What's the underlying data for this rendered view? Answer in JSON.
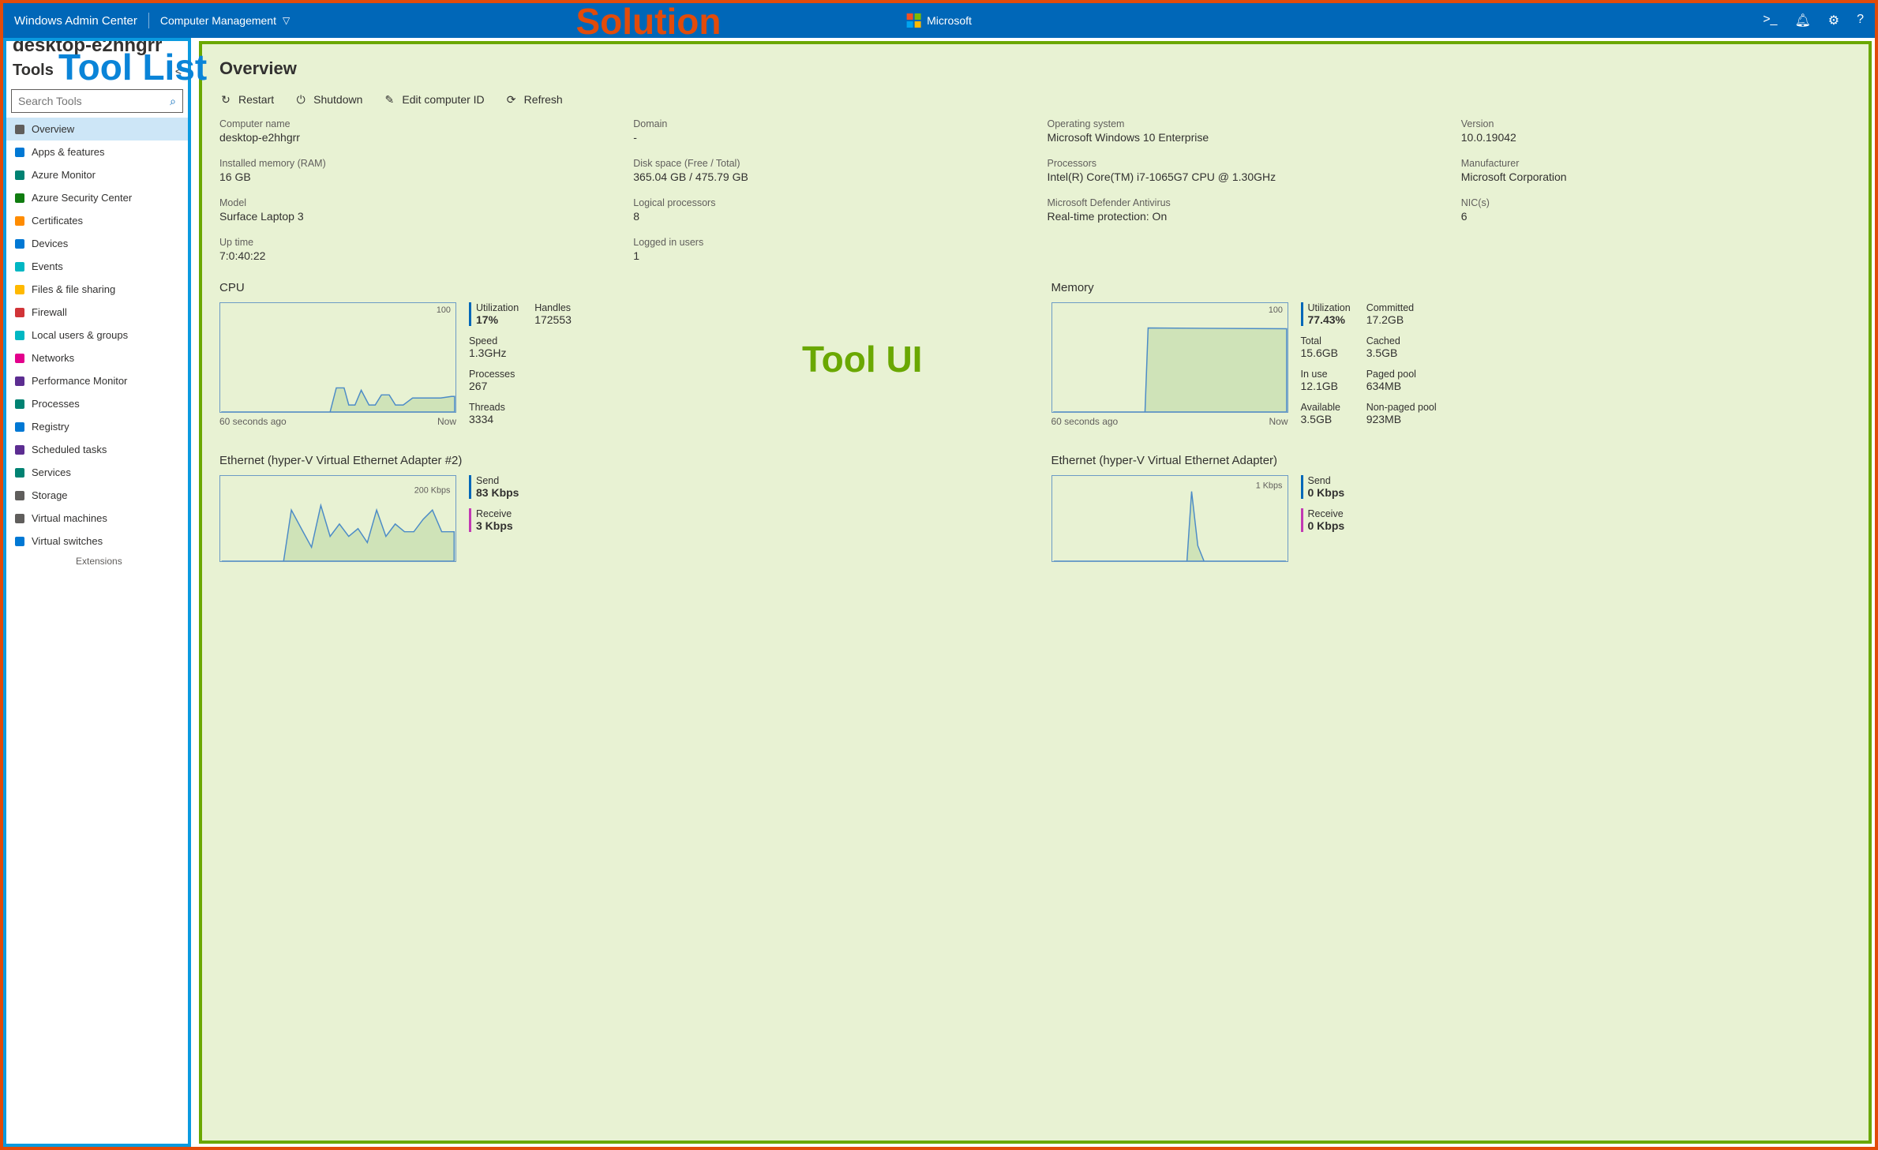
{
  "header": {
    "app_title": "Windows Admin Center",
    "solution_name": "Computer Management",
    "brand": "Microsoft"
  },
  "annotations": {
    "solution": "Solution",
    "tool_list": "Tool List",
    "tool_ui": "Tool UI"
  },
  "sidebar": {
    "connection_name": "desktop-e2hhgrr",
    "tools_label": "Tools",
    "search_placeholder": "Search Tools",
    "extensions_label": "Extensions",
    "items": [
      {
        "label": "Overview",
        "active": true
      },
      {
        "label": "Apps & features"
      },
      {
        "label": "Azure Monitor"
      },
      {
        "label": "Azure Security Center"
      },
      {
        "label": "Certificates"
      },
      {
        "label": "Devices"
      },
      {
        "label": "Events"
      },
      {
        "label": "Files & file sharing"
      },
      {
        "label": "Firewall"
      },
      {
        "label": "Local users & groups"
      },
      {
        "label": "Networks"
      },
      {
        "label": "Performance Monitor"
      },
      {
        "label": "Processes"
      },
      {
        "label": "Registry"
      },
      {
        "label": "Scheduled tasks"
      },
      {
        "label": "Services"
      },
      {
        "label": "Storage"
      },
      {
        "label": "Virtual machines"
      },
      {
        "label": "Virtual switches"
      }
    ]
  },
  "page": {
    "title": "Overview",
    "commands": {
      "restart": "Restart",
      "shutdown": "Shutdown",
      "edit_id": "Edit computer ID",
      "refresh": "Refresh"
    },
    "info": [
      {
        "lbl": "Computer name",
        "val": "desktop-e2hhgrr"
      },
      {
        "lbl": "Domain",
        "val": "-"
      },
      {
        "lbl": "Operating system",
        "val": "Microsoft Windows 10 Enterprise"
      },
      {
        "lbl": "Version",
        "val": "10.0.19042"
      },
      {
        "lbl": "Installed memory (RAM)",
        "val": "16 GB"
      },
      {
        "lbl": "Disk space (Free / Total)",
        "val": "365.04 GB / 475.79 GB"
      },
      {
        "lbl": "Processors",
        "val": "Intel(R) Core(TM) i7-1065G7 CPU @ 1.30GHz"
      },
      {
        "lbl": "Manufacturer",
        "val": "Microsoft Corporation"
      },
      {
        "lbl": "Model",
        "val": "Surface Laptop 3"
      },
      {
        "lbl": "Logical processors",
        "val": "8"
      },
      {
        "lbl": "Microsoft Defender Antivirus",
        "val": "Real-time protection: On"
      },
      {
        "lbl": "NIC(s)",
        "val": "6"
      },
      {
        "lbl": "Up time",
        "val": "7:0:40:22"
      },
      {
        "lbl": "Logged in users",
        "val": "1"
      }
    ],
    "axis": {
      "left": "60 seconds ago",
      "right": "Now"
    }
  },
  "cpu": {
    "title": "CPU",
    "ymax": "100",
    "ymin": "0",
    "metrics": {
      "utilization_lbl": "Utilization",
      "utilization": "17%",
      "handles_lbl": "Handles",
      "handles": "172553",
      "speed_lbl": "Speed",
      "speed": "1.3GHz",
      "processes_lbl": "Processes",
      "processes": "267",
      "threads_lbl": "Threads",
      "threads": "3334"
    }
  },
  "memory": {
    "title": "Memory",
    "ymax": "100",
    "ymin": "0",
    "metrics": {
      "utilization_lbl": "Utilization",
      "utilization": "77.43%",
      "committed_lbl": "Committed",
      "committed": "17.2GB",
      "total_lbl": "Total",
      "total": "15.6GB",
      "cached_lbl": "Cached",
      "cached": "3.5GB",
      "inuse_lbl": "In use",
      "inuse": "12.1GB",
      "paged_lbl": "Paged pool",
      "paged": "634MB",
      "avail_lbl": "Available",
      "avail": "3.5GB",
      "nonpaged_lbl": "Non-paged pool",
      "nonpaged": "923MB"
    }
  },
  "eth1": {
    "title": "Ethernet (hyper-V Virtual Ethernet Adapter #2)",
    "yunit": "200\nKbps",
    "send_lbl": "Send",
    "send": "83 Kbps",
    "recv_lbl": "Receive",
    "recv": "3 Kbps"
  },
  "eth2": {
    "title": "Ethernet (hyper-V Virtual Ethernet Adapter)",
    "yunit": "1 Kbps",
    "send_lbl": "Send",
    "send": "0 Kbps",
    "recv_lbl": "Receive",
    "recv": "0 Kbps"
  },
  "chart_data": [
    {
      "type": "area",
      "name": "CPU utilization",
      "x_unit": "seconds ago",
      "x": [
        60,
        55,
        50,
        45,
        40,
        35,
        33,
        31,
        29,
        27,
        25,
        23,
        20,
        18,
        16,
        14,
        12,
        10,
        8,
        6,
        4,
        2,
        0
      ],
      "values": [
        0,
        0,
        0,
        0,
        0,
        0,
        22,
        22,
        6,
        6,
        20,
        6,
        6,
        16,
        16,
        6,
        6,
        6,
        12,
        12,
        12,
        12,
        14
      ],
      "ylim": [
        0,
        100
      ],
      "xlabel": "60 seconds ago → Now",
      "ylabel": "%"
    },
    {
      "type": "area",
      "name": "Memory utilization",
      "x_unit": "seconds ago",
      "x": [
        60,
        55,
        50,
        45,
        40,
        38,
        36,
        30,
        20,
        10,
        0
      ],
      "values": [
        0,
        0,
        0,
        0,
        0,
        77,
        77,
        77,
        77,
        77,
        77
      ],
      "ylim": [
        0,
        100
      ],
      "xlabel": "60 seconds ago → Now",
      "ylabel": "%"
    },
    {
      "type": "area",
      "name": "Ethernet #2 throughput",
      "series": [
        {
          "name": "Send",
          "values": [
            0,
            0,
            0,
            120,
            80,
            40,
            130,
            60,
            90,
            60,
            80,
            50,
            120,
            60,
            90,
            70,
            70,
            100,
            120,
            70
          ]
        },
        {
          "name": "Receive",
          "values": [
            0,
            0,
            0,
            3,
            3,
            2,
            4,
            3,
            3,
            3,
            3,
            2,
            4,
            3,
            3,
            3,
            3,
            3,
            4,
            3
          ]
        }
      ],
      "x": [
        60,
        57,
        54,
        51,
        48,
        45,
        42,
        39,
        36,
        33,
        30,
        27,
        24,
        21,
        18,
        15,
        12,
        9,
        6,
        3
      ],
      "ylim": [
        0,
        200
      ],
      "yunit": "Kbps"
    },
    {
      "type": "area",
      "name": "Ethernet #1 throughput",
      "series": [
        {
          "name": "Send",
          "values": [
            0,
            0,
            0,
            0,
            0,
            0,
            0,
            0,
            0,
            0,
            0,
            0,
            0,
            0,
            0,
            0.9,
            0.2,
            0,
            0,
            0
          ]
        },
        {
          "name": "Receive",
          "values": [
            0,
            0,
            0,
            0,
            0,
            0,
            0,
            0,
            0,
            0,
            0,
            0,
            0,
            0,
            0,
            0,
            0,
            0,
            0,
            0
          ]
        }
      ],
      "x": [
        60,
        57,
        54,
        51,
        48,
        45,
        42,
        39,
        36,
        33,
        30,
        27,
        24,
        21,
        18,
        15,
        12,
        9,
        6,
        3
      ],
      "ylim": [
        0,
        1
      ],
      "yunit": "Kbps"
    }
  ]
}
